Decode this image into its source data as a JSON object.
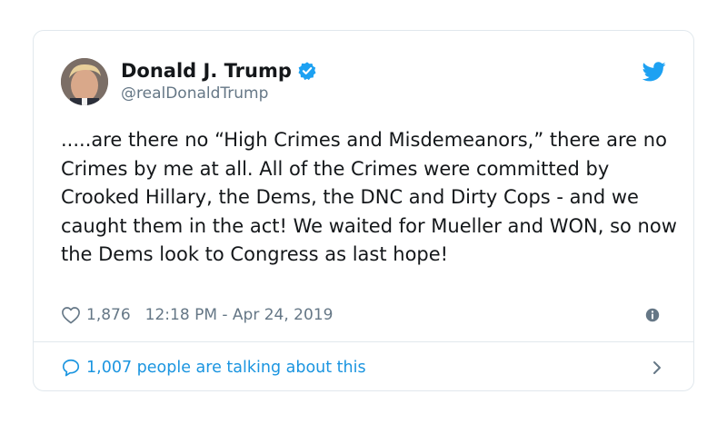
{
  "tweet": {
    "display_name": "Donald J. Trump",
    "handle": "@realDonaldTrump",
    "text": ".....are there no “High Crimes and Misdemeanors,” there are no Crimes by me at all. All of the Crimes were committed by Crooked Hillary, the Dems, the DNC and Dirty Cops - and we caught them in the act! We waited for Mueller and WON, so now the Dems look to Congress as last hope!",
    "likes": "1,876",
    "timestamp": "12:18 PM - Apr 24, 2019",
    "talking_label": "1,007 people are talking about this"
  },
  "icons": {
    "verified": "verified-badge-icon",
    "bird": "twitter-bird-icon",
    "heart": "heart-icon",
    "info": "info-icon",
    "comment": "comment-icon",
    "chevron": "chevron-right-icon"
  },
  "colors": {
    "accent": "#1da1f2",
    "link": "#1b95e0",
    "text": "#14171a",
    "muted": "#657786",
    "border": "#e1e8ed"
  }
}
